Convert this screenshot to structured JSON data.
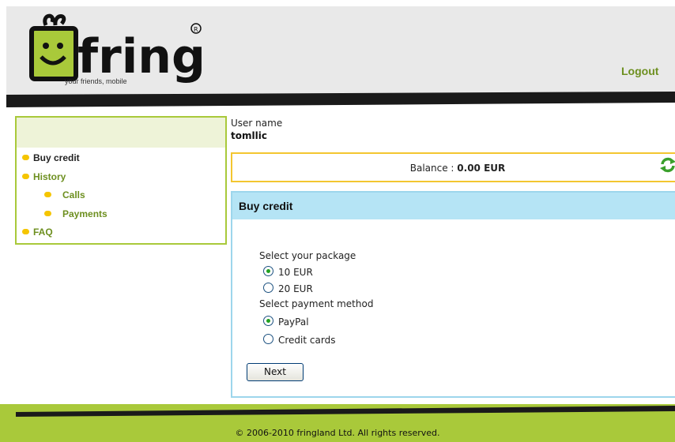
{
  "header": {
    "brand": "fring",
    "tagline": "your friends, mobile",
    "logout_label": "Logout"
  },
  "sidebar": {
    "items": [
      {
        "label": "Buy credit"
      },
      {
        "label": "History"
      },
      {
        "label": "Calls"
      },
      {
        "label": "Payments"
      },
      {
        "label": "FAQ"
      }
    ]
  },
  "user": {
    "label": "User name",
    "value": "tomllic"
  },
  "balance": {
    "label": "Balance : ",
    "value": "0.00 EUR"
  },
  "buy": {
    "title": "Buy credit",
    "package_label": "Select your package",
    "packages": [
      {
        "label": "10 EUR",
        "selected": true
      },
      {
        "label": "20 EUR",
        "selected": false
      }
    ],
    "payment_label": "Select payment method",
    "payments": [
      {
        "label": "PayPal",
        "selected": true
      },
      {
        "label": "Credit cards",
        "selected": false
      }
    ],
    "next_label": "Next"
  },
  "footer": {
    "copyright": "© 2006-2010 fringland Ltd. All rights reserved."
  },
  "colors": {
    "brand_green": "#a9c93a",
    "link_green": "#6d8f1f",
    "bullet_yellow": "#f5c500",
    "balance_border": "#f3c630",
    "panel_blue": "#b5e4f5"
  }
}
